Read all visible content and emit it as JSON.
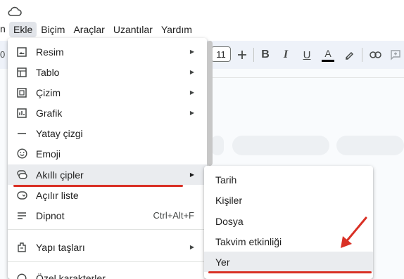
{
  "menubar": {
    "items": [
      {
        "label": "Ekle",
        "active": true
      },
      {
        "label": "Biçim"
      },
      {
        "label": "Araçlar"
      },
      {
        "label": "Uzantılar"
      },
      {
        "label": "Yardım"
      }
    ],
    "partial_left": "n"
  },
  "toolbar": {
    "partial_zoom": "0",
    "font_size": "11",
    "icons": [
      "plus-icon",
      "bold-icon",
      "italic-icon",
      "underline-icon",
      "text-color-icon",
      "highlight-icon",
      "link-icon",
      "comment-icon"
    ]
  },
  "insert_menu": {
    "items": [
      {
        "label": "Resim",
        "icon": "image-icon",
        "submenu": true
      },
      {
        "label": "Tablo",
        "icon": "table-icon",
        "submenu": true
      },
      {
        "label": "Çizim",
        "icon": "drawing-icon",
        "submenu": true
      },
      {
        "label": "Grafik",
        "icon": "chart-icon",
        "submenu": true
      },
      {
        "label": "Yatay çizgi",
        "icon": "horizontal-line-icon"
      },
      {
        "label": "Emoji",
        "icon": "emoji-icon"
      },
      {
        "label": "Akıllı çipler",
        "icon": "smart-chips-icon",
        "submenu": true,
        "highlighted": true
      },
      {
        "label": "Açılır liste",
        "icon": "dropdown-icon"
      },
      {
        "label": "Dipnot",
        "icon": "footnote-icon",
        "shortcut": "Ctrl+Alt+F"
      },
      {
        "label": "Yapı taşları",
        "icon": "building-blocks-icon",
        "submenu": true
      },
      {
        "label": "Özel karakterler",
        "icon": "special-chars-icon"
      }
    ]
  },
  "smart_chips_submenu": {
    "items": [
      {
        "label": "Tarih"
      },
      {
        "label": "Kişiler"
      },
      {
        "label": "Dosya"
      },
      {
        "label": "Takvim etkinliği"
      },
      {
        "label": "Yer",
        "highlighted": true
      }
    ]
  },
  "colors": {
    "annotation_red": "#d93025",
    "menu_highlight": "#eaecef",
    "toolbar_bg": "#eef2f9"
  }
}
